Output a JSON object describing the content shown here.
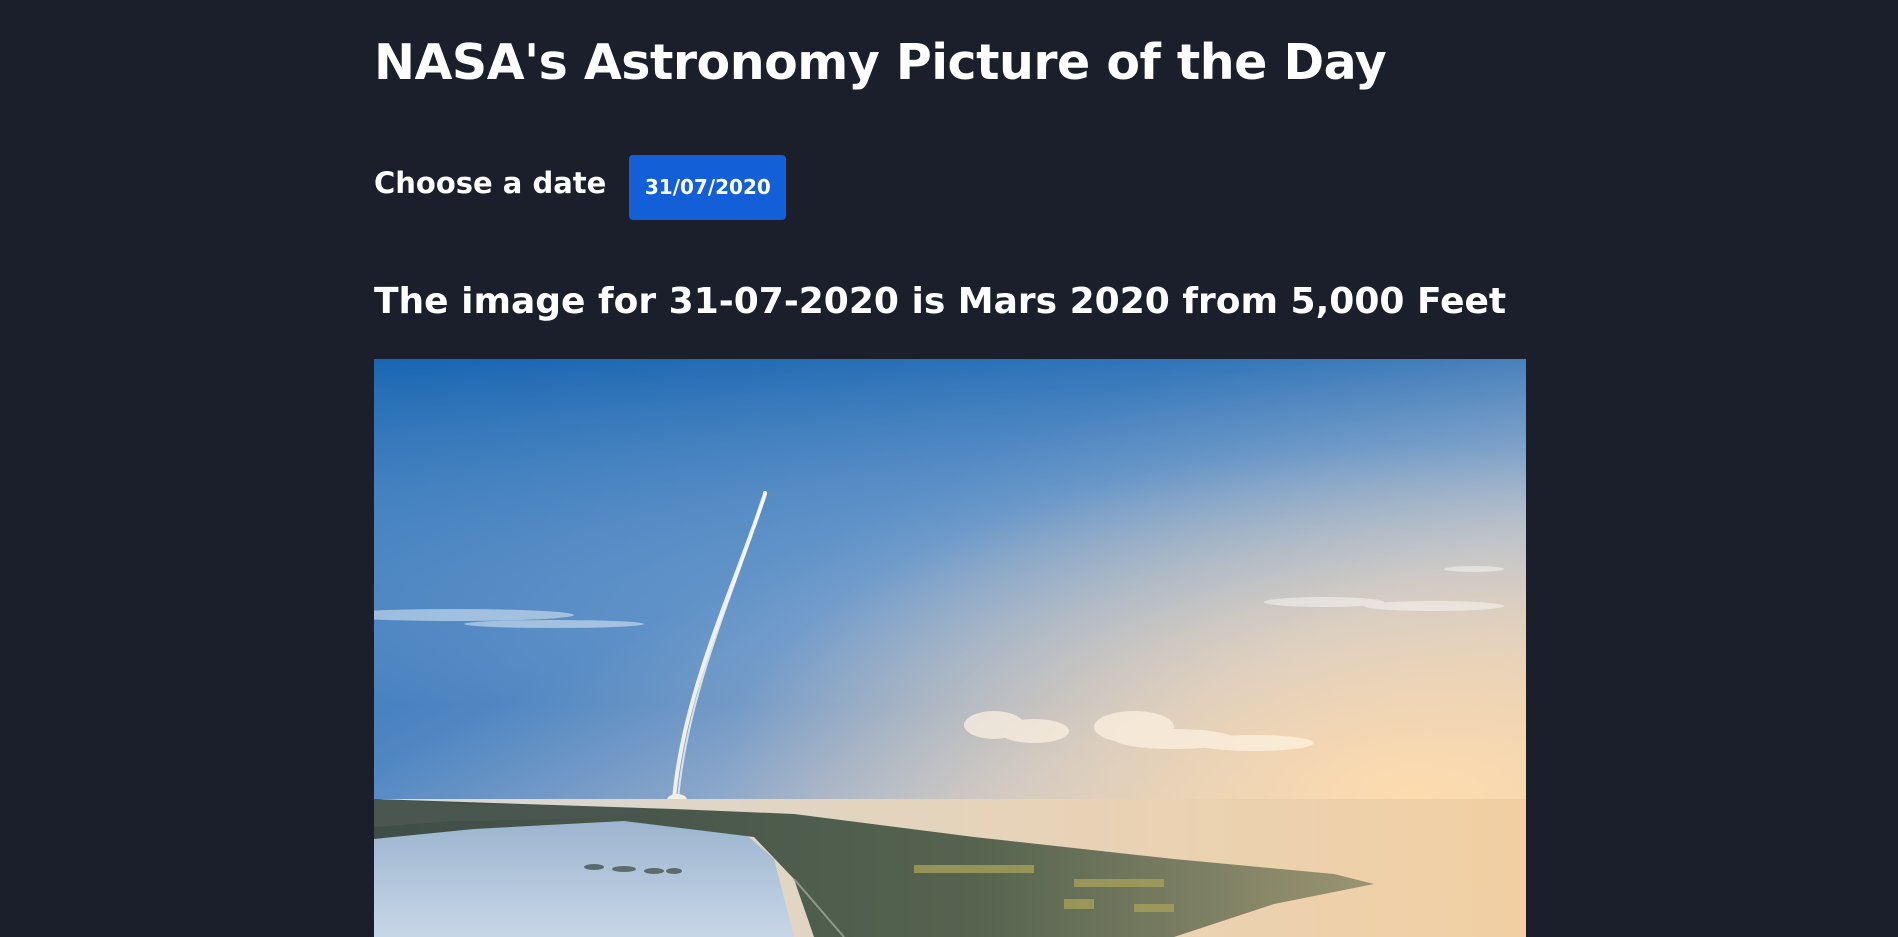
{
  "page": {
    "title": "NASA's Astronomy Picture of the Day"
  },
  "date_picker": {
    "label": "Choose a date",
    "value": "31/07/2020"
  },
  "apod": {
    "caption": "The image for 31-07-2020 is Mars 2020 from 5,000 Feet"
  },
  "colors": {
    "background": "#1b1f2b",
    "accent": "#135fd8",
    "text": "#ffffff"
  }
}
